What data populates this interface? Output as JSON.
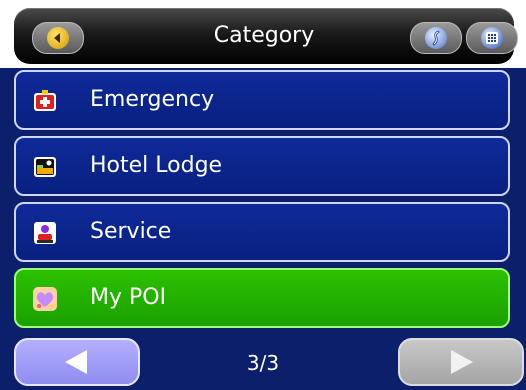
{
  "header": {
    "title": "Category",
    "back_icon": "back-arrow-icon",
    "route_icon": "route-icon",
    "menu_icon": "menu-icon"
  },
  "categories": [
    {
      "label": "Emergency",
      "icon": "emergency-icon",
      "selected": false
    },
    {
      "label": "Hotel Lodge",
      "icon": "hotel-icon",
      "selected": false
    },
    {
      "label": "Service",
      "icon": "service-icon",
      "selected": false
    },
    {
      "label": "My POI",
      "icon": "my-poi-icon",
      "selected": true
    }
  ],
  "pagination": {
    "current": "3/3",
    "prev_icon": "left-arrow-icon",
    "next_icon": "right-arrow-icon"
  },
  "colors": {
    "row": "#0f2a9a",
    "selected_row": "#2cc100",
    "background": "#0b1f6b"
  }
}
